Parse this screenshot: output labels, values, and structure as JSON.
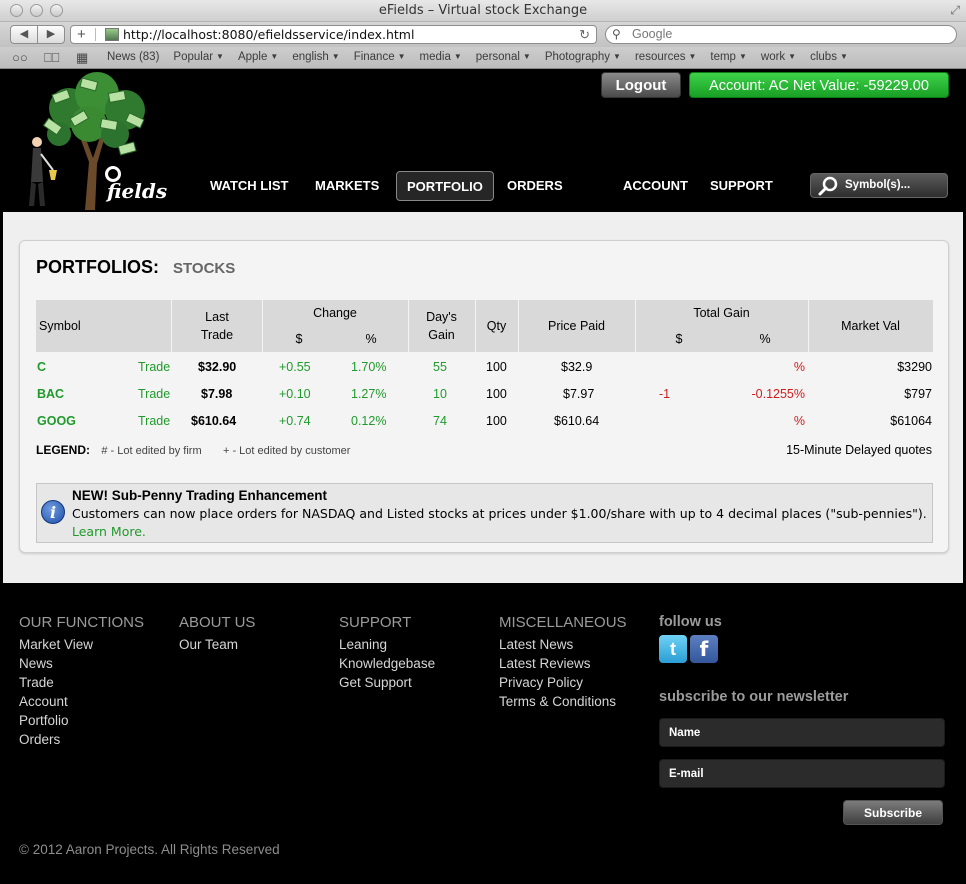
{
  "window": {
    "title": "eFields – Virtual stock Exchange",
    "url": "http://localhost:8080/efieldsservice/index.html",
    "search_placeholder": "Google"
  },
  "bookmarks": [
    {
      "label": "News (83)"
    },
    {
      "label": "Popular"
    },
    {
      "label": "Apple"
    },
    {
      "label": "english"
    },
    {
      "label": "Finance"
    },
    {
      "label": "media"
    },
    {
      "label": "personal"
    },
    {
      "label": "Photography"
    },
    {
      "label": "resources"
    },
    {
      "label": "temp"
    },
    {
      "label": "work"
    },
    {
      "label": "clubs"
    }
  ],
  "header": {
    "logout_label": "Logout",
    "account_text": "Account: AC Net Value: -59229.00",
    "logo_text": "fields",
    "nav": {
      "watch_list": "WATCH LIST",
      "markets": "MARKETS",
      "portfolio": "PORTFOLIO",
      "orders": "ORDERS",
      "account": "ACCOUNT",
      "support": "SUPPORT"
    },
    "symbol_search": "Symbol(s)..."
  },
  "portfolio": {
    "title": "PORTFOLIOS:",
    "subtitle": "STOCKS",
    "columns": {
      "symbol": "Symbol",
      "last_trade_1": "Last",
      "last_trade_2": "Trade",
      "change": "Change",
      "change_dollar": "$",
      "change_pct": "%",
      "days_gain_1": "Day's",
      "days_gain_2": "Gain",
      "qty": "Qty",
      "price_paid": "Price Paid",
      "total_gain": "Total Gain",
      "total_gain_dollar": "$",
      "total_gain_pct": "%",
      "market_val": "Market Val"
    },
    "rows": [
      {
        "symbol": "C",
        "trade": "Trade",
        "last": "$32.90",
        "chg": "+0.55",
        "chg_pct": "1.70%",
        "day_gain": "55",
        "qty": "100",
        "paid": "$32.9",
        "tg": "",
        "tg_pct": "%",
        "mval": "$3290"
      },
      {
        "symbol": "BAC",
        "trade": "Trade",
        "last": "$7.98",
        "chg": "+0.10",
        "chg_pct": "1.27%",
        "day_gain": "10",
        "qty": "100",
        "paid": "$7.97",
        "tg": "-1",
        "tg_pct": "-0.1255%",
        "mval": "$797"
      },
      {
        "symbol": "GOOG",
        "trade": "Trade",
        "last": "$610.64",
        "chg": "+0.74",
        "chg_pct": "0.12%",
        "day_gain": "74",
        "qty": "100",
        "paid": "$610.64",
        "tg": "",
        "tg_pct": "%",
        "mval": "$61064"
      }
    ],
    "legend": {
      "label": "LEGEND:",
      "firm": "# - Lot edited by firm",
      "customer": "+ - Lot edited by customer"
    },
    "delayed": "15-Minute Delayed quotes",
    "notice": {
      "title": "NEW! Sub-Penny Trading Enhancement",
      "body": "Customers can now place orders for NASDAQ and Listed stocks at prices under $1.00/share with up to 4 decimal places (\"sub-pennies\"). ",
      "link": "Learn More."
    }
  },
  "footer": {
    "functions": {
      "title": "OUR FUNCTIONS",
      "links": [
        "Market View",
        "News",
        "Trade",
        "Account",
        "Portfolio",
        "Orders"
      ]
    },
    "about": {
      "title": "ABOUT US",
      "links": [
        "Our Team"
      ]
    },
    "support": {
      "title": "SUPPORT",
      "links": [
        "Leaning",
        "Knowledgebase",
        "Get Support"
      ]
    },
    "misc": {
      "title": "MISCELLANEOUS",
      "links": [
        "Latest News",
        "Latest Reviews",
        "Privacy Policy",
        "Terms & Conditions"
      ]
    },
    "follow": "follow us",
    "subscribe_title": "subscribe to our newsletter",
    "name_label": "Name",
    "email_label": "E-mail",
    "subscribe_button": "Subscribe",
    "copyright": "© 2012 Aaron Projects. All Rights Reserved"
  },
  "colors": {
    "accent_green": "#1f9a2b",
    "loss_red": "#d11d1d",
    "account_badge": "#18a024"
  }
}
